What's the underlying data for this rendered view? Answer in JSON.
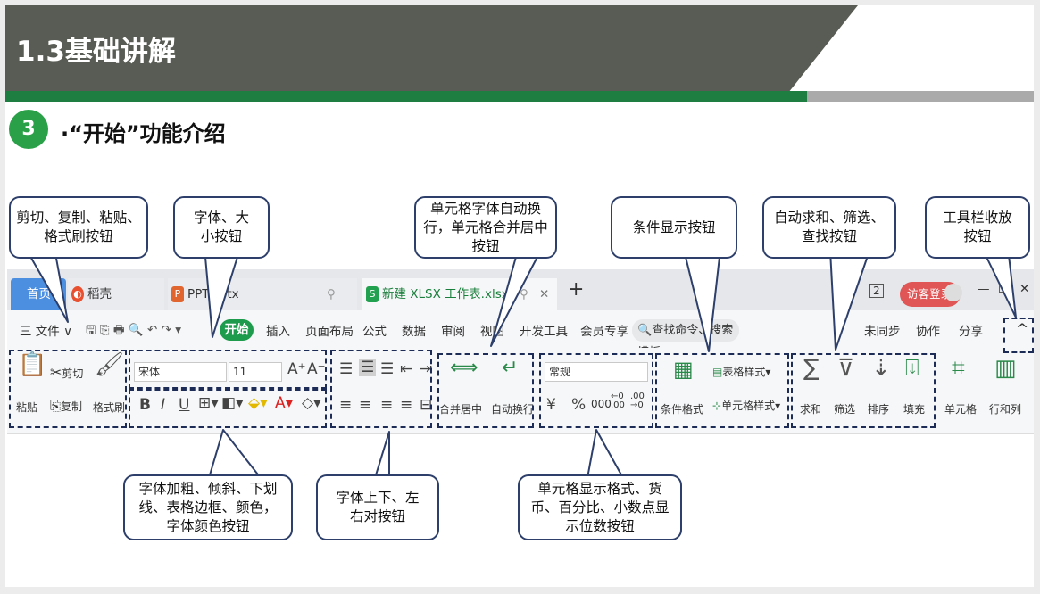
{
  "header": {
    "title": "1.3基础讲解"
  },
  "section": {
    "number": "3",
    "title": "·“开始”功能介绍"
  },
  "callouts": {
    "clipboard": "剪切、复制、粘贴、格式刷按钮",
    "font_size": "字体、大小按钮",
    "wrap_merge": "单元格字体自动换行，单元格合并居中按钮",
    "conditional": "条件显示按钮",
    "sum_filter": "自动求和、筛选、查找按钮",
    "collapse": "工具栏收放按钮",
    "font_style": "字体加粗、倾斜、下划线、表格边框、颜色，字体颜色按钮",
    "align": "字体上下、左右对按钮",
    "number_format": "单元格显示格式、货币、百分比、小数点显示位数按钮"
  },
  "wps": {
    "tabs": [
      "首页",
      "稻壳",
      "PPT.pptx",
      "新建 XLSX 工作表.xlsx"
    ],
    "new_tab": "+",
    "login": "访客登录",
    "window_buttons": [
      "2",
      "—",
      "☐",
      "✕"
    ],
    "file_menu": "三 文件",
    "menu": [
      "开始",
      "插入",
      "页面布局",
      "公式",
      "数据",
      "审阅",
      "视图",
      "开发工具",
      "会员专享"
    ],
    "search": "查找命令、搜索模板",
    "right_menu": [
      "未同步",
      "协作",
      "分享"
    ],
    "collapse_icon": "^",
    "clipboard": {
      "cut": "剪切",
      "copy": "复制",
      "paste": "粘贴",
      "format_painter": "格式刷"
    },
    "font_name": "宋体",
    "font_size": "11",
    "bold": "B",
    "italic": "I",
    "underline": "U",
    "font_size_increase": "A⁺",
    "font_size_decrease": "A⁻",
    "merge": "合并居中",
    "wrap": "自动换行",
    "number_format": "常规",
    "currency": "¥",
    "percent": "%",
    "thousands": "000",
    "inc_decimal": "←0 .00",
    "dec_decimal": ".00 →0",
    "conditional_format": "条件格式",
    "table_style": "表格样式",
    "cell_style": "单元格样式",
    "sum": "求和",
    "filter": "筛选",
    "sort": "排序",
    "fill": "填充",
    "cell": "单元格",
    "row_col": "行和列"
  },
  "colors": {
    "header_dark": "#595c54",
    "header_green": "#1e7e42",
    "circle": "#2aa148",
    "callout_border": "#2d3f6a",
    "wps_green": "#1e9b4c"
  }
}
